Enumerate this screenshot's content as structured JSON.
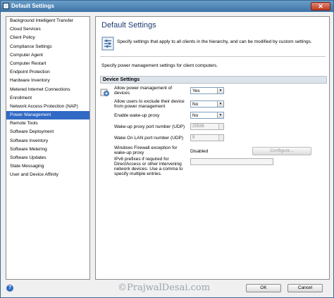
{
  "window": {
    "title": "Default Settings"
  },
  "sidebar": {
    "items": [
      "Background Intelligent Transfer",
      "Cloud Services",
      "Client Policy",
      "Compliance Settings",
      "Computer Agent",
      "Computer Restart",
      "Endpoint Protection",
      "Hardware Inventory",
      "Metered Internet Connections",
      "Enrollment",
      "Network Access Protection (NAP)",
      "Power Management",
      "Remote Tools",
      "Software Deployment",
      "Software Inventory",
      "Software Metering",
      "Software Updates",
      "State Messaging",
      "User and Device Affinity"
    ],
    "selected": "Power Management"
  },
  "main": {
    "title": "Default Settings",
    "description": "Specify settings that apply to all clients in the hierarchy, and can be modified by custom settings.",
    "subdescription": "Specify power management settings for client computers.",
    "group_header": "Device Settings",
    "settings": {
      "allow_pm_label": "Allow power management of devices",
      "allow_pm_value": "Yes",
      "allow_exclude_label": "Allow users to exclude their device from power management",
      "allow_exclude_value": "No",
      "wake_proxy_label": "Enable wake-up proxy",
      "wake_proxy_value": "No",
      "proxy_port_label": "Wake-up proxy port number (UDP)",
      "proxy_port_value": "25536",
      "wol_port_label": "Wake On LAN port number (UDP)",
      "wol_port_value": "9",
      "firewall_label": "Windows Firewall exception for wake-up proxy",
      "firewall_value": "Disabled",
      "configure_label": "Configure...",
      "ipv6_label": "IPv6 prefixes if required for DirectAccess or other intervening network devices. Use a comma to specify multiple entries."
    }
  },
  "footer": {
    "watermark": "©PrajwalDesai.com",
    "ok_label": "OK",
    "cancel_label": "Cancel",
    "help_icon_glyph": "?"
  },
  "colors": {
    "selection": "#316ac5",
    "title_accent": "#1a3c6e"
  }
}
